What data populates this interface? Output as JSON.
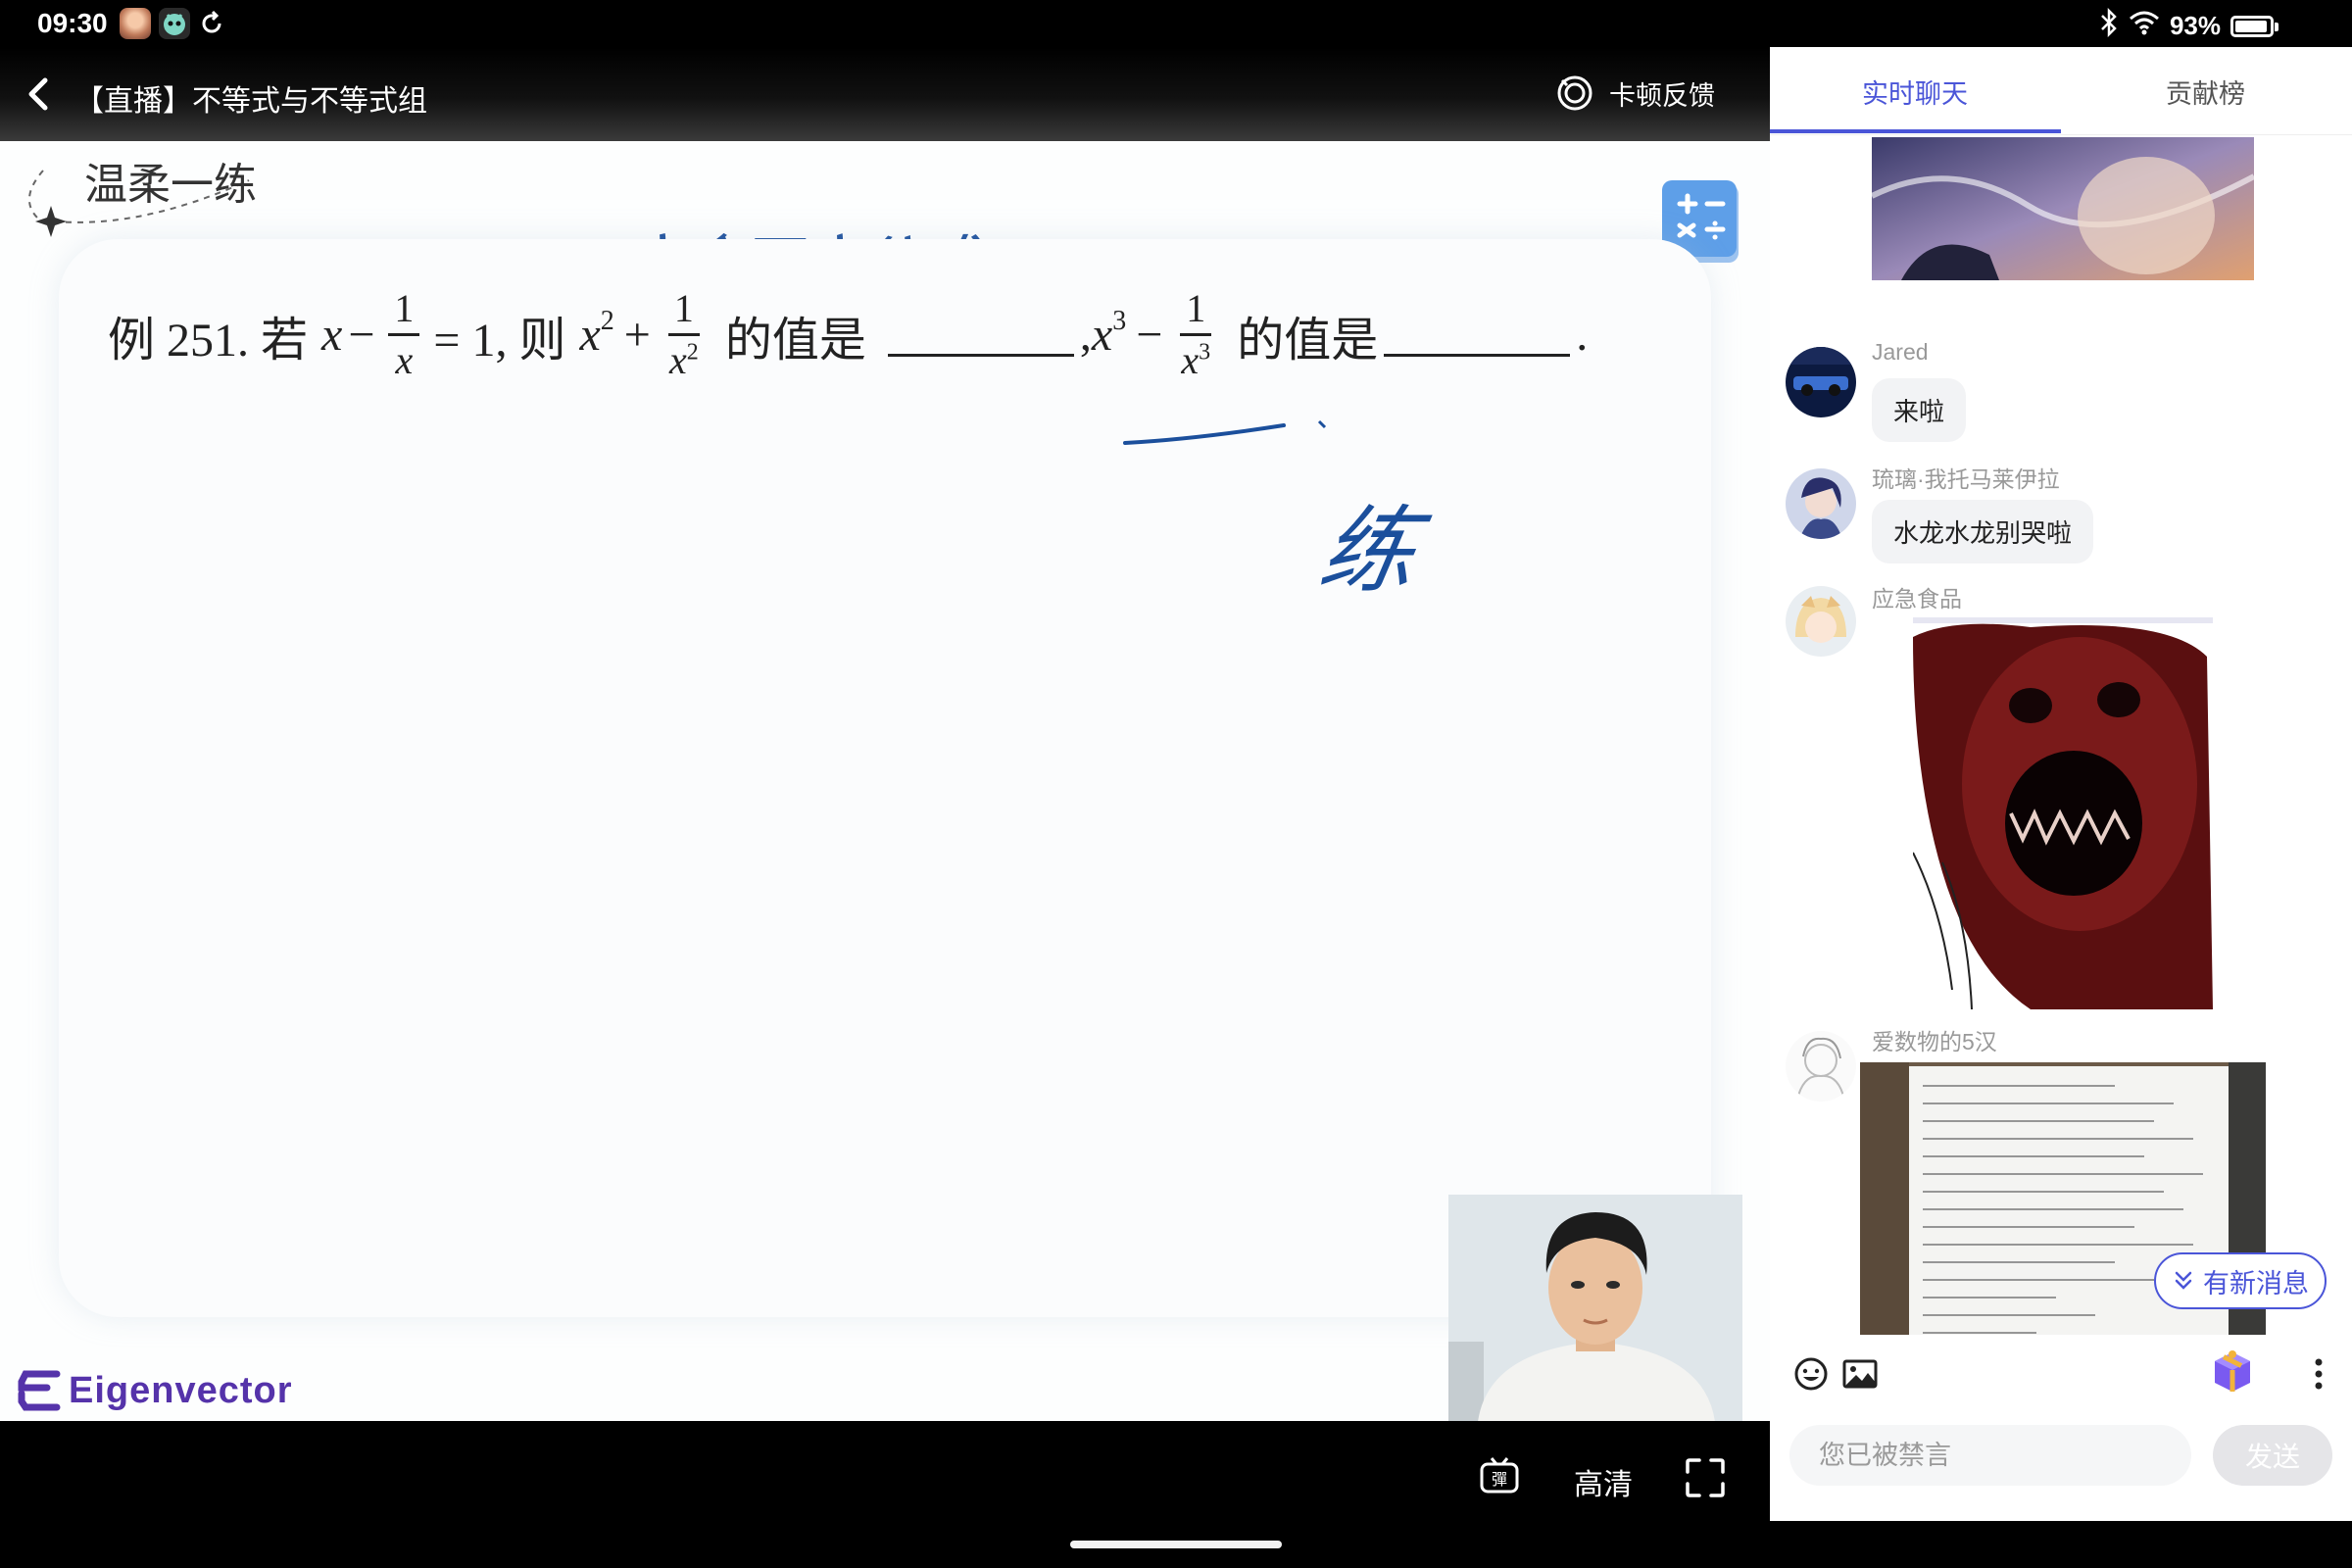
{
  "status_bar": {
    "time": "09:30",
    "battery": "93%",
    "battery_level": 0.93
  },
  "header": {
    "title": "【直播】不等式与不等式组",
    "feedback_label": "卡顿反馈"
  },
  "board": {
    "practice_tag": "温柔一练",
    "problem": {
      "prefix": "例 251. 若",
      "var_x": "x",
      "minus": "−",
      "one": "1",
      "eq_rest": "= 1, 则",
      "x2": "x",
      "sup2": "2",
      "plus": "+",
      "den_x2": "x",
      "value_is_1": "的值是",
      "comma": ",",
      "x3": "x",
      "sup3": "3",
      "den_x3": "x",
      "value_is_2": "的值是",
      "period": "."
    },
    "handwriting_1": "完全平方公式",
    "handwriting_2": "练",
    "logo": "Eigenvector"
  },
  "controls": {
    "quality_label": "高清"
  },
  "chat": {
    "tabs": [
      {
        "label": "实时聊天"
      },
      {
        "label": "贡献榜"
      }
    ],
    "messages": [
      {
        "user": "Jared",
        "text": "来啦"
      },
      {
        "user": "琉璃·我托马莱伊拉",
        "text": "水龙水龙别哭啦"
      },
      {
        "user": "应急食品"
      },
      {
        "user": "爱数物的5汉"
      }
    ],
    "new_message_label": "有新消息",
    "input_placeholder": "您已被禁言",
    "send_label": "发送"
  },
  "colors": {
    "accent": "#4a55d8",
    "ink": "#1b4f9c"
  }
}
